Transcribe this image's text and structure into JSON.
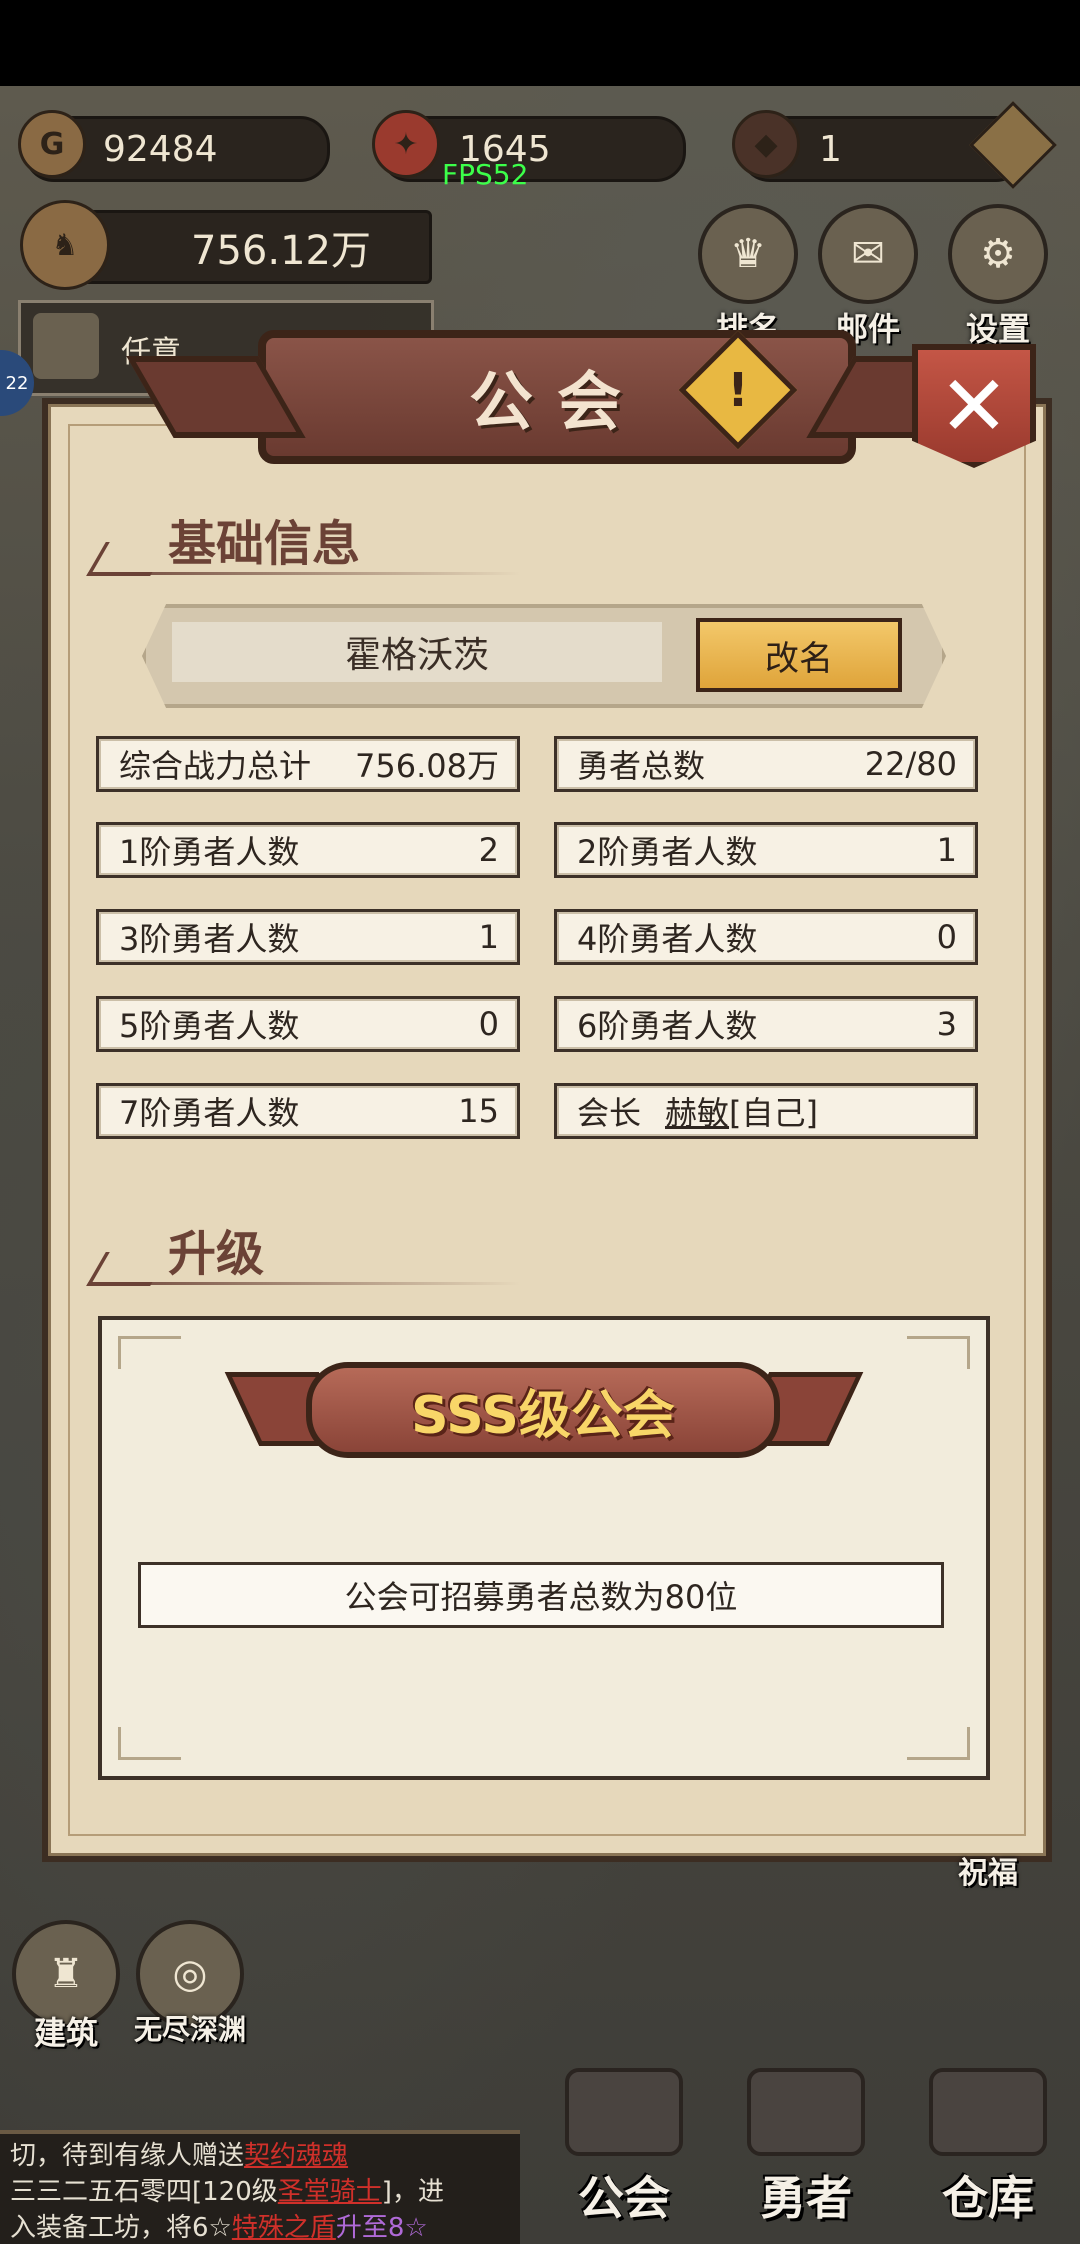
{
  "hud": {
    "gold": "92484",
    "honor": "1645",
    "gem": "1",
    "fps": "FPS52",
    "power": "756.12万",
    "task_text": "任意",
    "side_badge": "22"
  },
  "top_buttons": [
    {
      "label": "排名",
      "icon": "trophy-icon"
    },
    {
      "label": "邮件",
      "icon": "mail-icon"
    },
    {
      "label": "设置",
      "icon": "gear-icon"
    }
  ],
  "dialog": {
    "title": "公会",
    "section_basic": "基础信息",
    "guild_name": "霍格沃茨",
    "rename_label": "改名",
    "stats_left": [
      {
        "label": "综合战力总计",
        "value": "756.08万"
      },
      {
        "label": "1阶勇者人数",
        "value": "2"
      },
      {
        "label": "3阶勇者人数",
        "value": "1"
      },
      {
        "label": "5阶勇者人数",
        "value": "0"
      },
      {
        "label": "7阶勇者人数",
        "value": "15"
      }
    ],
    "stats_right": [
      {
        "label": "勇者总数",
        "value": "22/80"
      },
      {
        "label": "2阶勇者人数",
        "value": "1"
      },
      {
        "label": "4阶勇者人数",
        "value": "0"
      },
      {
        "label": "6阶勇者人数",
        "value": "3"
      }
    ],
    "leader_label": "会长",
    "leader_name": "赫敏",
    "leader_self": "[自己]",
    "section_upgrade": "升级",
    "grade": "SSS级公会",
    "grade_desc": "公会可招募勇者总数为80位"
  },
  "side_buttons": {
    "build": "建筑",
    "abyss": "无尽深渊",
    "bless": "祝福"
  },
  "chat": {
    "line1_prefix": "切，",
    "line1_text": "待到有缘人赠送",
    "line1_link": "契约魂魂",
    "line2_prefix": "三三二五石零四[120级",
    "line2_link": "圣堂骑士",
    "line2_suffix": "]，进",
    "line3_prefix": "入装备工坊，将6☆",
    "line3_link": "特殊之盾",
    "line3_suffix": "升至8☆"
  },
  "nav": [
    {
      "label": "公会",
      "icon": "guild-hall-icon"
    },
    {
      "label": "勇者",
      "icon": "hero-helmet-icon"
    },
    {
      "label": "仓库",
      "icon": "warehouse-icon"
    }
  ],
  "colors": {
    "panel": "#e6d8bb",
    "title_banner": "#8a5448",
    "rename_button": "#f3c86a",
    "close_button": "#c45646",
    "section_text": "#6b4236",
    "grade_text": "#f8d668",
    "fps_text": "#3cff4a"
  }
}
